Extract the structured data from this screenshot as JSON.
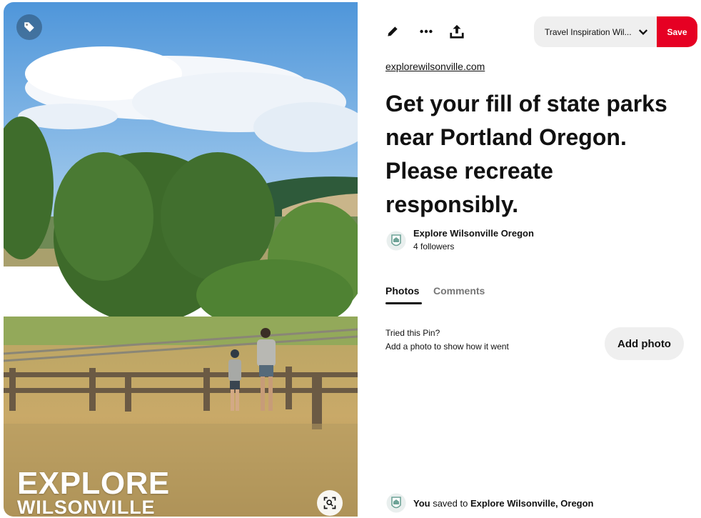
{
  "image": {
    "watermark_line1": "EXPLORE",
    "watermark_line2": "WILSONVILLE",
    "tag_icon": "tag-icon",
    "visual_search_icon": "visual-search-icon"
  },
  "toolbar": {
    "edit_icon": "pencil-icon",
    "more_icon": "more-dots-icon",
    "share_icon": "share-upload-icon",
    "board_name": "Travel Inspiration Wil...",
    "save_label": "Save"
  },
  "pin": {
    "source": "explorewilsonville.com",
    "title": "Get your fill of state parks near Portland Oregon. Please recreate responsibly."
  },
  "creator": {
    "name": "Explore Wilsonville Oregon",
    "followers": "4 followers"
  },
  "tabs": {
    "photos": "Photos",
    "comments": "Comments"
  },
  "tried": {
    "title": "Tried this Pin?",
    "subtitle": "Add a photo to show how it went",
    "button": "Add photo"
  },
  "saved": {
    "prefix": "You",
    "middle": " saved to ",
    "board": "Explore Wilsonville, Oregon"
  },
  "colors": {
    "save_red": "#e60023",
    "button_gray": "#efefef",
    "text": "#111111",
    "muted": "#767676"
  }
}
